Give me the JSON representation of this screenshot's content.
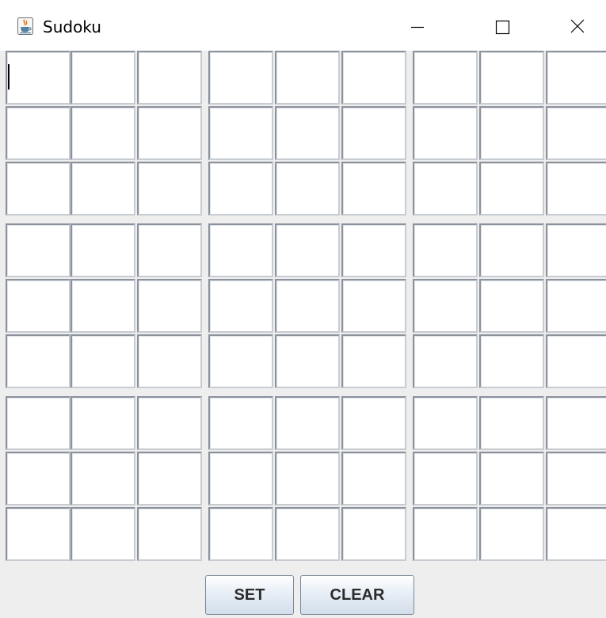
{
  "window": {
    "title": "Sudoku",
    "icon": "java-coffee-cup-icon",
    "controls": [
      "minimize-icon",
      "maximize-icon",
      "close-icon"
    ]
  },
  "board": {
    "rows": 9,
    "columns": 9,
    "cells": [
      [
        "",
        "",
        "",
        "",
        "",
        "",
        "",
        "",
        ""
      ],
      [
        "",
        "",
        "",
        "",
        "",
        "",
        "",
        "",
        ""
      ],
      [
        "",
        "",
        "",
        "",
        "",
        "",
        "",
        "",
        ""
      ],
      [
        "",
        "",
        "",
        "",
        "",
        "",
        "",
        "",
        ""
      ],
      [
        "",
        "",
        "",
        "",
        "",
        "",
        "",
        "",
        ""
      ],
      [
        "",
        "",
        "",
        "",
        "",
        "",
        "",
        "",
        ""
      ],
      [
        "",
        "",
        "",
        "",
        "",
        "",
        "",
        "",
        ""
      ],
      [
        "",
        "",
        "",
        "",
        "",
        "",
        "",
        "",
        ""
      ],
      [
        "",
        "",
        "",
        "",
        "",
        "",
        "",
        "",
        ""
      ]
    ],
    "focused_cell": "r1c1"
  },
  "buttons": {
    "set_label": "SET",
    "clear_label": "CLEAR"
  },
  "colors": {
    "window_background": "#f0f0f0",
    "cell_border_dark": "#8b929c",
    "cell_border_light": "#c7ccd2",
    "button_border": "#7a8a99"
  }
}
